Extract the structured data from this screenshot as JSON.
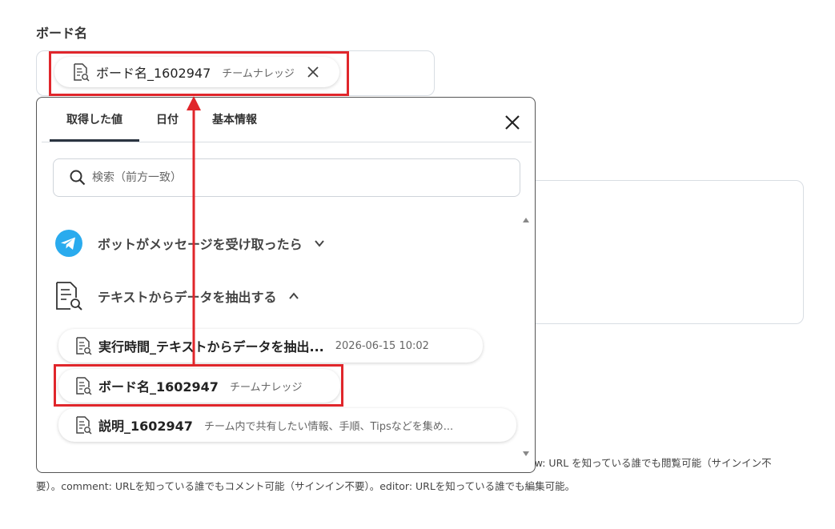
{
  "field": {
    "label": "ボード名",
    "selected_chip": {
      "main": "ボード名_1602947",
      "sub": "チームナレッジ"
    }
  },
  "popup": {
    "tabs": [
      "取得した値",
      "日付",
      "基本情報"
    ],
    "active_tab": 0,
    "search_placeholder": "検索（前方一致）",
    "sections": [
      {
        "title": "ボットがメッセージを受け取ったら",
        "expanded": false,
        "icon": "telegram-icon"
      },
      {
        "title": "テキストからデータを抽出する",
        "expanded": true,
        "icon": "document-search-icon"
      }
    ],
    "items": [
      {
        "main": "実行時間_テキストからデータを抽出...",
        "sub": "2026-06-15 10:02"
      },
      {
        "main": "ボード名_1602947",
        "sub": "チームナレッジ"
      },
      {
        "main": "説明_1602947",
        "sub": "チーム内で共有したい情報、手順、Tipsなどを集め..."
      }
    ]
  },
  "help": {
    "line1": "ew: URL を知っている誰でも閲覧可能（サインイン不",
    "line2": "要）。comment: URLを知っている誰でもコメント可能（サインイン不要）。editor: URLを知っている誰でも編集可能。"
  },
  "colors": {
    "highlight": "#e0262b",
    "telegram": "#2AABEE",
    "tab_underline": "#2b3440"
  }
}
